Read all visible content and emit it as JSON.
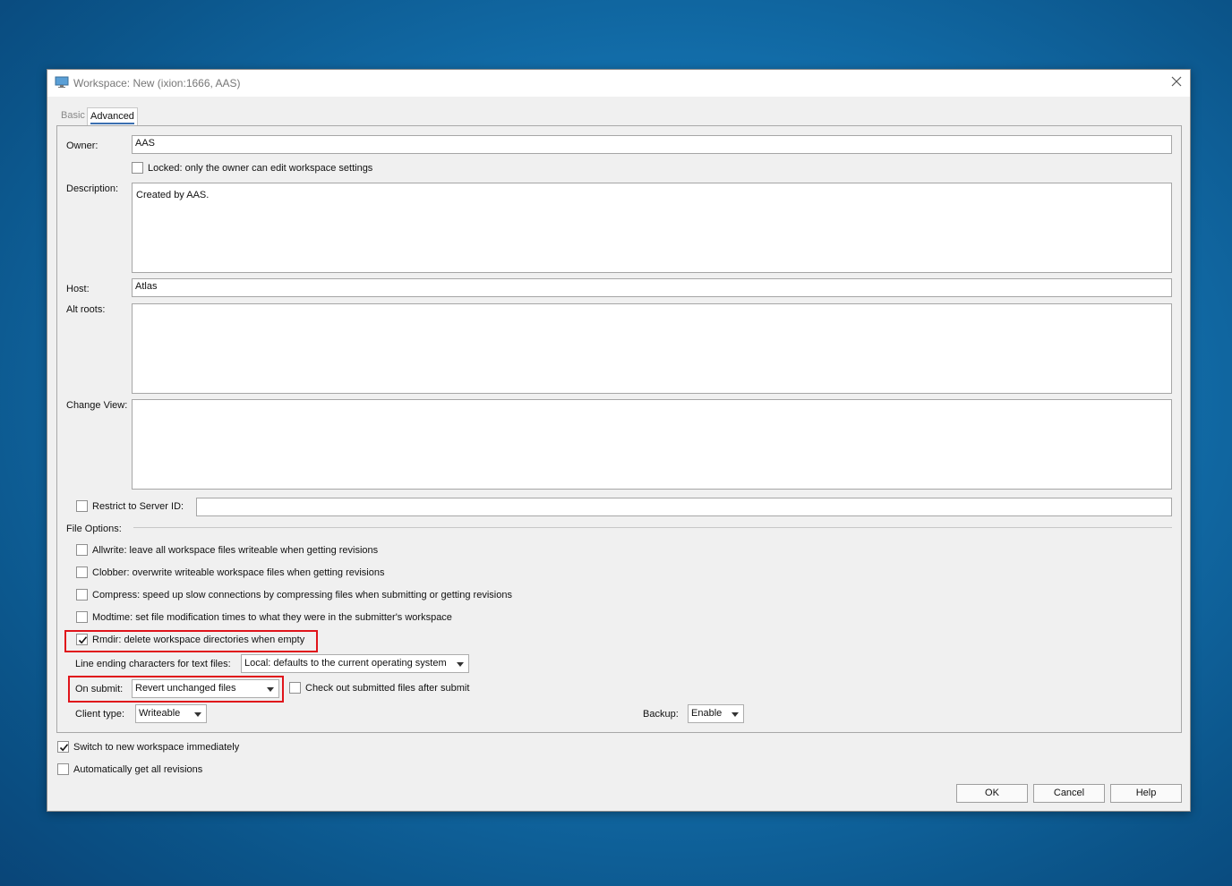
{
  "window": {
    "title": "Workspace: New (ixion:1666,  AAS)"
  },
  "tabs": {
    "basic": "Basic",
    "advanced": "Advanced"
  },
  "owner": {
    "label": "Owner:",
    "value": "AAS"
  },
  "locked": {
    "label": "Locked: only the owner can edit workspace settings",
    "checked": false
  },
  "description": {
    "label": "Description:",
    "value": "Created by AAS."
  },
  "host": {
    "label": "Host:",
    "value": "Atlas"
  },
  "alt_roots": {
    "label": "Alt roots:",
    "value": ""
  },
  "change_view": {
    "label": "Change View:",
    "value": ""
  },
  "restrict": {
    "label": "Restrict to Server ID:",
    "value": "",
    "checked": false
  },
  "file_options": {
    "label": "File Options:",
    "items": [
      {
        "label": "Allwrite: leave all workspace files writeable when getting revisions",
        "checked": false
      },
      {
        "label": "Clobber: overwrite writeable workspace files when getting revisions",
        "checked": false
      },
      {
        "label": "Compress: speed up slow connections by compressing files when submitting or getting revisions",
        "checked": false
      },
      {
        "label": "Modtime: set file modification times to what they were in the submitter's workspace",
        "checked": false
      },
      {
        "label": "Rmdir: delete workspace directories when empty",
        "checked": true
      }
    ]
  },
  "line_ending": {
    "label": "Line ending characters for text files:",
    "value": "Local: defaults to the current operating system"
  },
  "on_submit": {
    "label": "On submit:",
    "value": "Revert unchanged files"
  },
  "checkout_after_submit": {
    "label": "Check out submitted files after submit",
    "checked": false
  },
  "client_type": {
    "label": "Client type:",
    "value": "Writeable"
  },
  "backup": {
    "label": "Backup:",
    "value": "Enable"
  },
  "switch_workspace": {
    "label": "Switch to new workspace immediately",
    "checked": true
  },
  "auto_get": {
    "label": "Automatically get all revisions",
    "checked": false
  },
  "buttons": {
    "ok": "OK",
    "cancel": "Cancel",
    "help": "Help"
  },
  "colors": {
    "highlight": "#e0141b",
    "tab_underline": "#3b6fb0"
  }
}
